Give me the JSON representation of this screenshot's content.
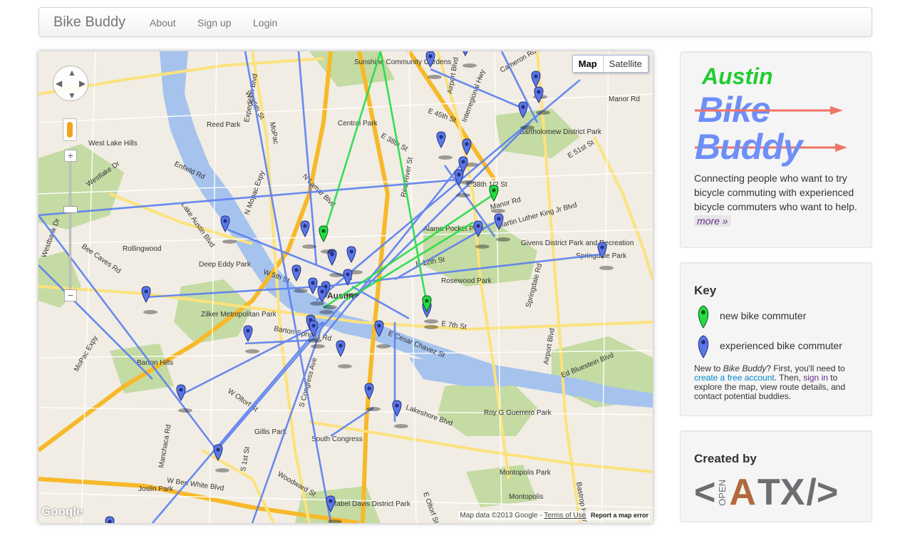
{
  "navbar": {
    "brand": "Bike Buddy",
    "links": [
      "About",
      "Sign up",
      "Login"
    ]
  },
  "map": {
    "maptype_map": "Map",
    "maptype_satellite": "Satellite",
    "attribution": "Map data ©2013 Google -",
    "terms": "Terms of Use",
    "report": "Report a map error",
    "google_logo": "Google",
    "labels": [
      "Sunshine Community Gardens",
      "W 35th St",
      "Reed Park",
      "Central Park",
      "E 45th St",
      "Bartholomew District Park",
      "E 51st St",
      "West Lake Hills",
      "Enfield Rd",
      "N Lamar Blvd",
      "Manor Rd",
      "Alamo Pocket Park",
      "Givens District Park and Recreation",
      "Springdale Park",
      "Rollingwood",
      "Deep Eddy Park",
      "W 5th St",
      "E 12th St",
      "Rosewood Park",
      "Zilker Metropolitan Park",
      "Barton Springs Rd",
      "E 7th St",
      "E Cesar Chavez St",
      "Barton Hills",
      "Ed Bluestein Blvd",
      "W Oltorf St",
      "Gillis Park",
      "South Congress",
      "Roy G Guerrero Park",
      "Joslin Park",
      "W Ben White Blvd",
      "Woodward St",
      "Mabel Davis District Park",
      "Montopolis Park",
      "Montopolis",
      "Lakeshore Blvd",
      "Bee Caves Rd",
      "MoPac Expy",
      "Expedition Blvd",
      "S Congress Ave",
      "E Oltorf St",
      "Airport Blvd",
      "Springdale Rd",
      "Cameron Rd",
      "Manor Rd",
      "Airport Blvd",
      "Interregional Hwy",
      "E 38th St",
      "Red River St",
      "E 38th 1/2 St",
      "Martin Luther King Jr Blvd",
      "Austin",
      "Manchaca Rd",
      "S 1st St",
      "Bastrop Hwy",
      "Lake Austin Blvd",
      "Westlake Dr",
      "N Mopac Expy",
      "MoPac",
      "Westbank Dr"
    ],
    "routes": [
      {
        "kind": "green"
      },
      {
        "kind": "blue"
      }
    ],
    "colors": {
      "water": "#a6c3ee",
      "park": "#c4dba3",
      "highway": "#f7b92a",
      "arterial": "#fbe27d",
      "route_blue": "#5b7ff0",
      "route_green": "#22dd44"
    }
  },
  "logo": {
    "austin": "Austin",
    "bike": "Bike",
    "buddy": "Buddy"
  },
  "intro": {
    "text": "Connecting people who want to try bicycle commuting with experienced bicycle commuters who want to help.",
    "more": "more »"
  },
  "key": {
    "title": "Key",
    "new_label": "new bike commuter",
    "experienced_label": "experienced bike commuter",
    "note_1": "New to ",
    "note_brand": "Bike Buddy",
    "note_2": "? First, you'll need to ",
    "note_link1": "create a free account",
    "note_3": ". Then, ",
    "note_link2": "sign in",
    "note_4": " to explore the map, view route details, and contact potential buddies."
  },
  "created": {
    "title": "Created by",
    "open": "OPEN",
    "lt": "<",
    "a": "A",
    "tx": "TX",
    "slash": "/>"
  }
}
